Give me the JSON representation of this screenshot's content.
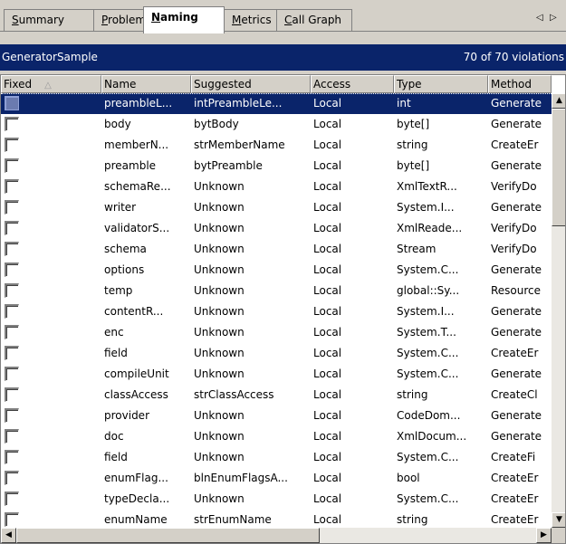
{
  "tabs": [
    {
      "pre": "",
      "mn": "S",
      "post": "ummary"
    },
    {
      "pre": "",
      "mn": "P",
      "post": "roblems"
    },
    {
      "pre": "",
      "mn": "N",
      "post": "aming"
    },
    {
      "pre": "",
      "mn": "M",
      "post": "etrics"
    },
    {
      "pre": "",
      "mn": "C",
      "post": "all Graph"
    }
  ],
  "active_tab": 2,
  "tab_nav": {
    "prev_icon": "◁",
    "next_icon": "▷"
  },
  "header": {
    "title": "GeneratorSample",
    "count": "70 of 70 violations"
  },
  "columns": [
    "Fixed",
    "Name",
    "Suggested",
    "Access",
    "Type",
    "Method"
  ],
  "sort_icon": "△",
  "rows": [
    {
      "name": "preambleL...",
      "suggested": "intPreambleLe...",
      "access": "Local",
      "type": "int",
      "method": "Generate"
    },
    {
      "name": "body",
      "suggested": "bytBody",
      "access": "Local",
      "type": "byte[]",
      "method": "Generate"
    },
    {
      "name": "memberN...",
      "suggested": "strMemberName",
      "access": "Local",
      "type": "string",
      "method": "CreateEr"
    },
    {
      "name": "preamble",
      "suggested": "bytPreamble",
      "access": "Local",
      "type": "byte[]",
      "method": "Generate"
    },
    {
      "name": "schemaRe...",
      "suggested": "Unknown",
      "access": "Local",
      "type": "XmlTextR...",
      "method": "VerifyDo"
    },
    {
      "name": "writer",
      "suggested": "Unknown",
      "access": "Local",
      "type": "System.I...",
      "method": "Generate"
    },
    {
      "name": "validatorS...",
      "suggested": "Unknown",
      "access": "Local",
      "type": "XmlReade...",
      "method": "VerifyDo"
    },
    {
      "name": "schema",
      "suggested": "Unknown",
      "access": "Local",
      "type": "Stream",
      "method": "VerifyDo"
    },
    {
      "name": "options",
      "suggested": "Unknown",
      "access": "Local",
      "type": "System.C...",
      "method": "Generate"
    },
    {
      "name": "temp",
      "suggested": "Unknown",
      "access": "Local",
      "type": "global::Sy...",
      "method": "Resource"
    },
    {
      "name": "contentR...",
      "suggested": "Unknown",
      "access": "Local",
      "type": "System.I...",
      "method": "Generate"
    },
    {
      "name": "enc",
      "suggested": "Unknown",
      "access": "Local",
      "type": "System.T...",
      "method": "Generate"
    },
    {
      "name": "field",
      "suggested": "Unknown",
      "access": "Local",
      "type": "System.C...",
      "method": "CreateEr"
    },
    {
      "name": "compileUnit",
      "suggested": "Unknown",
      "access": "Local",
      "type": "System.C...",
      "method": "Generate"
    },
    {
      "name": "classAccess",
      "suggested": "strClassAccess",
      "access": "Local",
      "type": "string",
      "method": "CreateCl"
    },
    {
      "name": "provider",
      "suggested": "Unknown",
      "access": "Local",
      "type": "CodeDom...",
      "method": "Generate"
    },
    {
      "name": "doc",
      "suggested": "Unknown",
      "access": "Local",
      "type": "XmlDocum...",
      "method": "Generate"
    },
    {
      "name": "field",
      "suggested": "Unknown",
      "access": "Local",
      "type": "System.C...",
      "method": "CreateFi"
    },
    {
      "name": "enumFlag...",
      "suggested": "blnEnumFlagsA...",
      "access": "Local",
      "type": "bool",
      "method": "CreateEr"
    },
    {
      "name": "typeDecla...",
      "suggested": "Unknown",
      "access": "Local",
      "type": "System.C...",
      "method": "CreateEr"
    },
    {
      "name": "enumName",
      "suggested": "strEnumName",
      "access": "Local",
      "type": "string",
      "method": "CreateEr"
    }
  ],
  "selected_row": 0,
  "scroll_icons": {
    "up": "▲",
    "down": "▼",
    "left": "◀",
    "right": "▶"
  },
  "colors": {
    "selection": "#0a246a",
    "chrome": "#d4d0c8"
  }
}
